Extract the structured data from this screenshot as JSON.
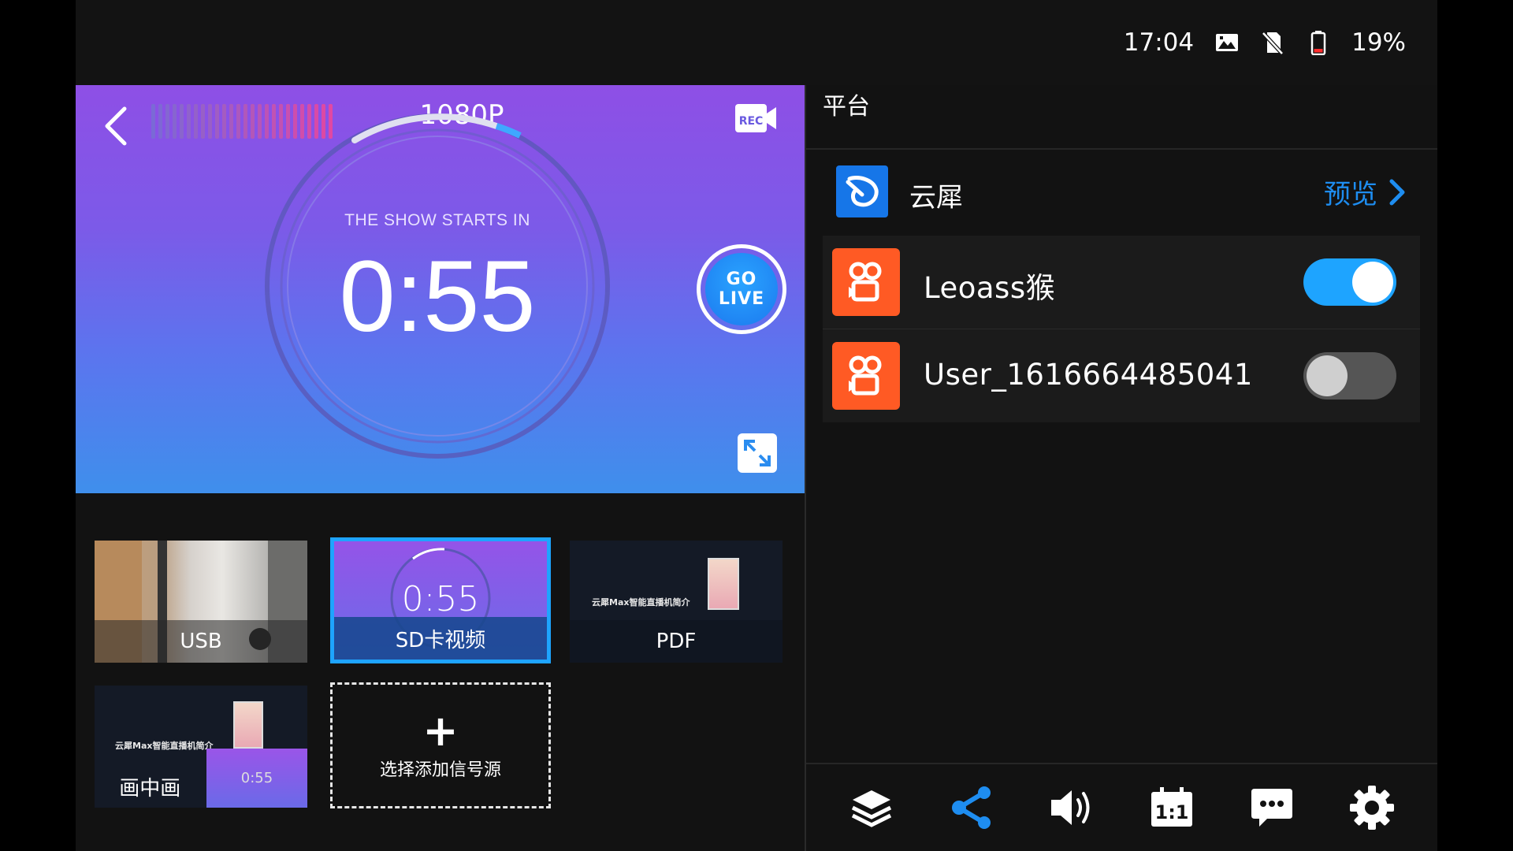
{
  "status_bar": {
    "time": "17:04",
    "battery": "19%",
    "icons": [
      "gallery-icon",
      "no-sim-icon",
      "battery-low-icon"
    ]
  },
  "preview": {
    "resolution": "1080P",
    "countdown_caption": "THE SHOW STARTS IN",
    "countdown": "0:55",
    "go_live_line1": "GO",
    "go_live_line2": "LIVE",
    "rec_label": "REC",
    "icons": [
      "back-icon",
      "record-icon",
      "fullscreen-icon"
    ]
  },
  "sources": {
    "tiles": [
      {
        "label": "USB"
      },
      {
        "label": "SD卡视频",
        "selected": true,
        "thumb_time": "0:55"
      },
      {
        "label": "PDF",
        "thumb_text": "云犀Max智能直播机简介"
      },
      {
        "label": "画中画",
        "thumb_text": "云犀Max智能直播机简介",
        "thumb_time": "0:55"
      }
    ],
    "add_label": "选择添加信号源"
  },
  "platform": {
    "title": "平台",
    "provider_name": "云犀",
    "preview_label": "预览",
    "accounts": [
      {
        "name": "Leoass猴",
        "enabled": true
      },
      {
        "name": "User_1616664485041",
        "enabled": false
      }
    ]
  },
  "toolbar": {
    "icons": [
      "layers-icon",
      "share-icon",
      "volume-icon",
      "aspect-ratio-icon",
      "chat-icon",
      "settings-icon"
    ],
    "active": "share-icon",
    "aspect_label": "1:1"
  },
  "colors": {
    "accent": "#1e8df0",
    "platform_orange": "#ff5a24",
    "toggle_on": "#1ea4ff",
    "toggle_off": "#555555"
  }
}
